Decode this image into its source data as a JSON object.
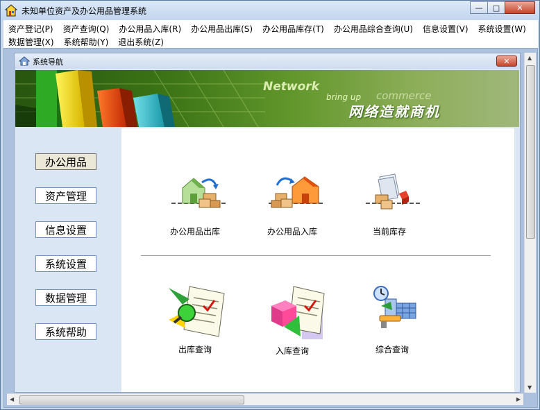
{
  "window": {
    "title": "未知单位资产及办公用品管理系统",
    "minimize_label": "—",
    "maximize_label": "□",
    "close_label": "✕"
  },
  "menu": {
    "row1": [
      "资产登记(P)",
      "资产查询(Q)",
      "办公用品入库(R)",
      "办公用品出库(S)",
      "办公用品库存(T)",
      "办公用品综合查询(U)",
      "信息设置(V)",
      "系统设置(W)"
    ],
    "row2": [
      "数据管理(X)",
      "系统帮助(Y)",
      "退出系统(Z)"
    ]
  },
  "child_window": {
    "title": "系统导航",
    "close_label": "✕"
  },
  "banner": {
    "network": "Network",
    "bring_up": "bring up",
    "commerce": "commerce",
    "slogan": "网络造就商机"
  },
  "nav": {
    "items": [
      "办公用品",
      "资产管理",
      "信息设置",
      "系统设置",
      "数据管理",
      "系统帮助"
    ],
    "active_index": 0
  },
  "content": {
    "row1": [
      {
        "label": "办公用品出库",
        "icon": "warehouse-out-icon"
      },
      {
        "label": "办公用品入库",
        "icon": "warehouse-in-icon"
      },
      {
        "label": "当前库存",
        "icon": "inventory-icon"
      }
    ],
    "row2": [
      {
        "label": "出库查询",
        "icon": "out-query-icon"
      },
      {
        "label": "入库查询",
        "icon": "in-query-icon"
      },
      {
        "label": "综合查询",
        "icon": "combined-query-icon"
      }
    ]
  },
  "colors": {
    "banner_green": "#4b8a1c",
    "titlebar": "#c2d6ef",
    "close_red": "#c7442b",
    "nav_border": "#6f8fbf"
  }
}
